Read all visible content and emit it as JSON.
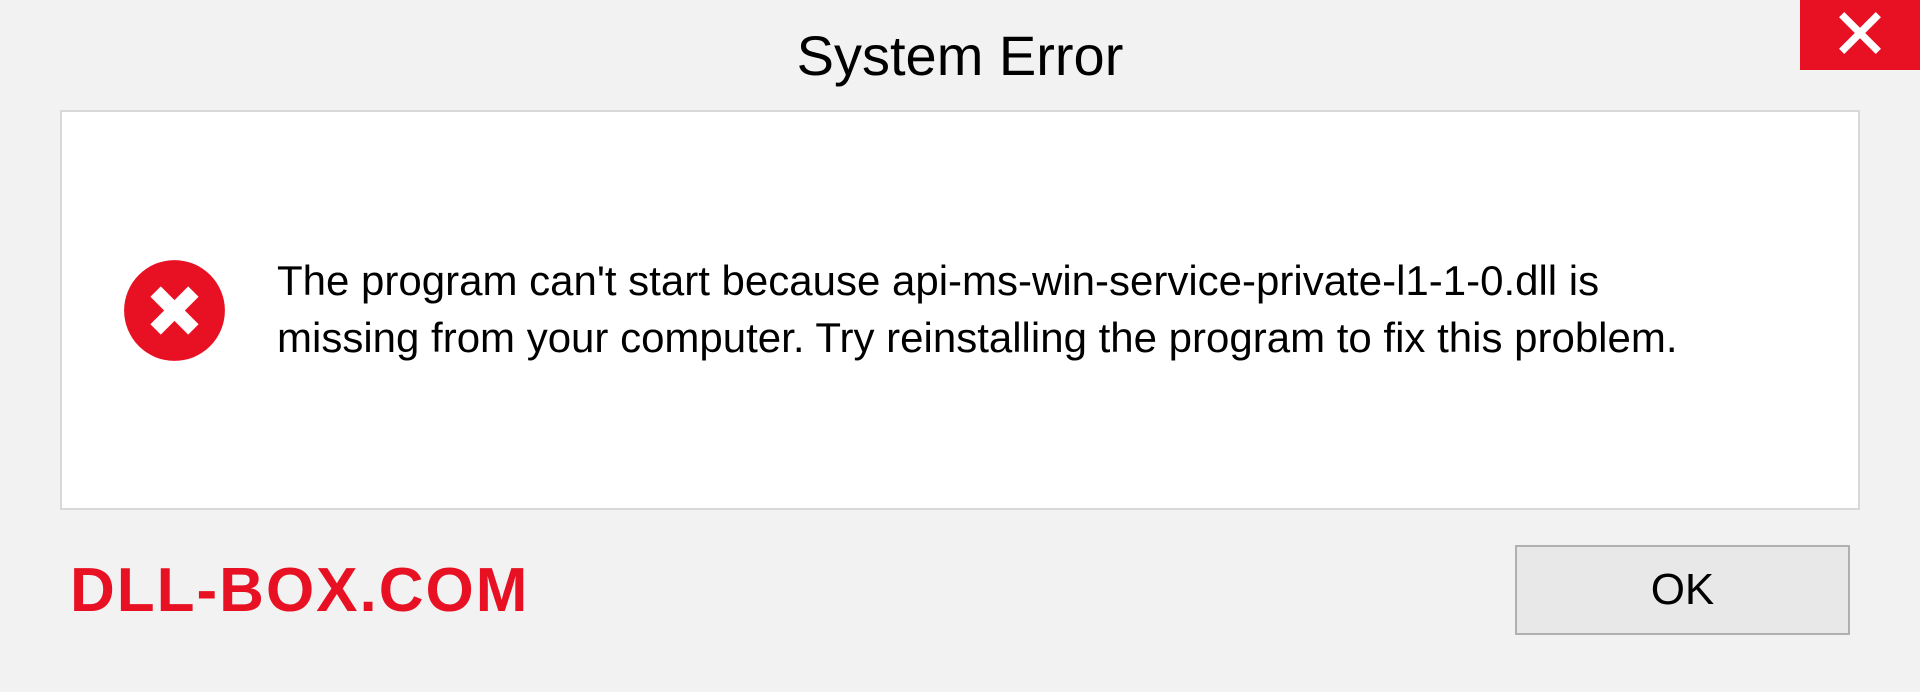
{
  "dialog": {
    "title": "System Error",
    "message": "The program can't start because api-ms-win-service-private-l1-1-0.dll is missing from your computer. Try reinstalling the program to fix this problem.",
    "ok_label": "OK"
  },
  "watermark": "DLL-BOX.COM",
  "colors": {
    "accent_red": "#e81123",
    "panel_bg": "#ffffff",
    "body_bg": "#f2f2f2"
  }
}
